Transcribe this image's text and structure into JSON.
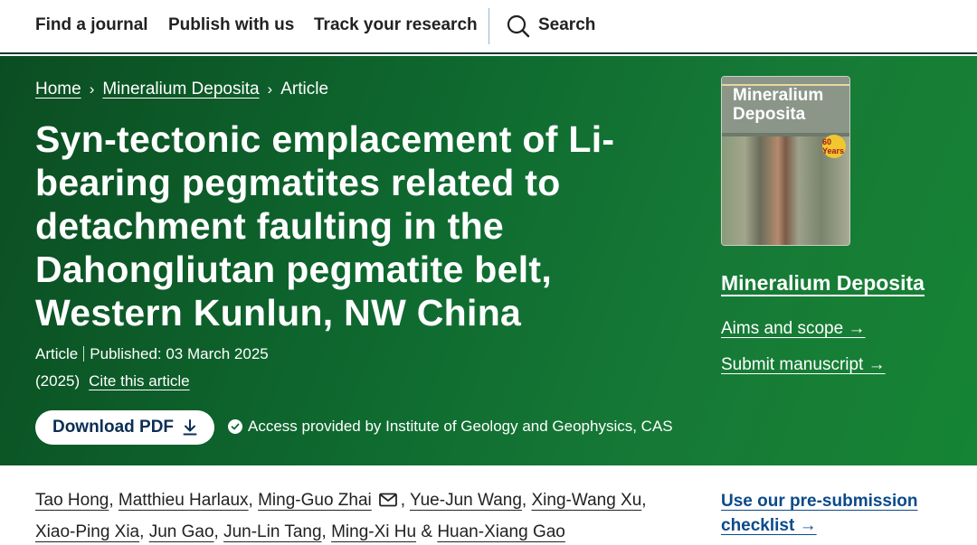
{
  "nav": {
    "find_journal": "Find a journal",
    "publish": "Publish with us",
    "track": "Track your research",
    "search": "Search"
  },
  "breadcrumb": {
    "home": "Home",
    "journal": "Mineralium Deposita",
    "current": "Article",
    "separator": "›"
  },
  "article": {
    "title": "Syn-tectonic emplacement of Li-bearing pegmatites related to detachment faulting in the Dahongliutan pegmatite belt, Western Kunlun, NW China",
    "type": "Article",
    "published": "Published: 03 March 2025",
    "year": "(2025)",
    "cite": "Cite this article",
    "download_pdf": "Download PDF",
    "access": "Access provided by Institute of Geology and Geophysics, CAS"
  },
  "sidebar": {
    "cover_title": "Mineralium Deposita",
    "cover_badge": "60 Years",
    "journal_name": "Mineralium Deposita",
    "aims": "Aims and scope →",
    "submit": "Submit manuscript →",
    "presubmission": "Use our pre-submission checklist →"
  },
  "authors": {
    "list": [
      "Tao Hong",
      "Matthieu Harlaux",
      "Ming-Guo Zhai",
      "Yue-Jun Wang",
      "Xing-Wang Xu",
      "Xiao-Ping Xia",
      "Jun Gao",
      "Jun-Lin Tang",
      "Ming-Xi Hu",
      "Huan-Xiang Gao"
    ],
    "comma": ",",
    "ampersand": "&"
  },
  "colors": {
    "hero_green": "#0f6b30",
    "link_blue": "#0b4a8a",
    "button_text": "#0b2e55"
  }
}
